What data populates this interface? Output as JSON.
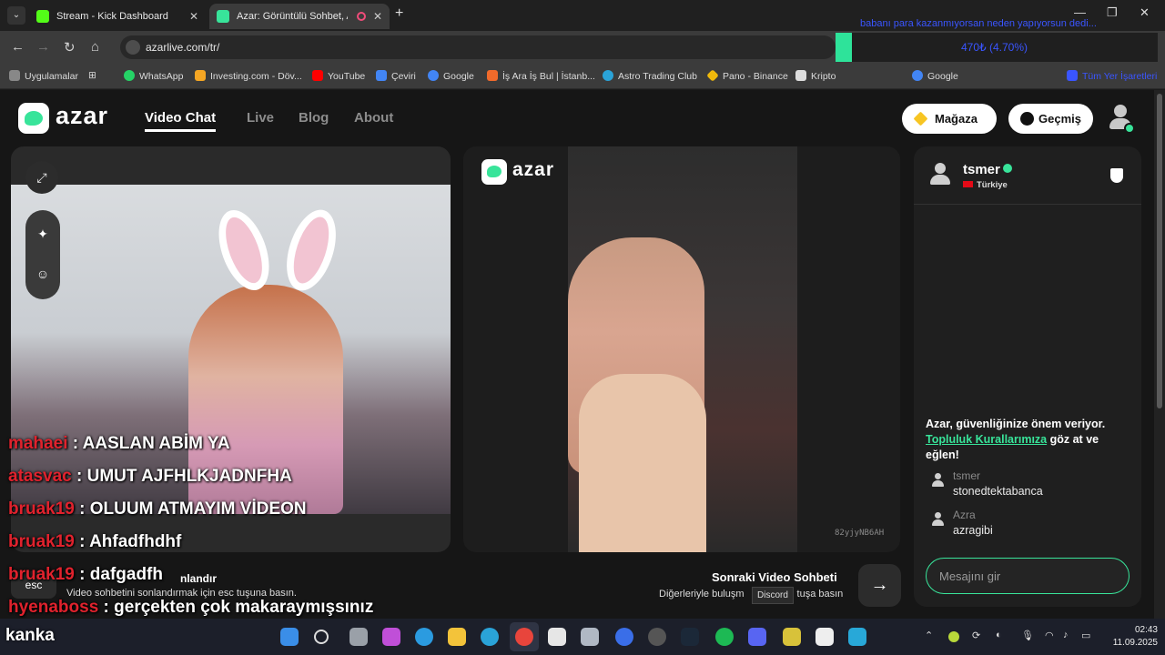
{
  "browser": {
    "tabs": [
      {
        "label": "Stream - Kick Dashboard",
        "color": "#53fc18"
      },
      {
        "label": "Azar: Görüntülü Sohbet, An",
        "color": "#38e49a"
      }
    ],
    "url": "azarlive.com/tr/",
    "bookmarks": [
      {
        "label": "Uygulamalar",
        "color": "#888888"
      },
      {
        "label": "WhatsApp",
        "color": "#25d366"
      },
      {
        "label": "Investing.com - Döv...",
        "color": "#f5a623"
      },
      {
        "label": "YouTube",
        "color": "#ff0000"
      },
      {
        "label": "Çeviri",
        "color": "#4285f4"
      },
      {
        "label": "Google",
        "color": "#4285f4"
      },
      {
        "label": "İş Ara İş Bul | İstanb...",
        "color": "#f06a2b"
      },
      {
        "label": "Astro Trading Club",
        "color": "#2aa3d8"
      },
      {
        "label": "Pano - Binance",
        "color": "#f0b90b"
      },
      {
        "label": "Kripto",
        "color": "#dddddd"
      },
      {
        "label": "Google",
        "color": "#4285f4"
      }
    ],
    "other_bookmarks": "Tüm Yer İşaretleri"
  },
  "stream_overlay": {
    "alert_text": "babanı para kazanmıyorsan neden yapıyorsun dedi...",
    "ticker_value": "470₺ (4.70%)",
    "chat_lines": [
      {
        "user": "mahaei",
        "message": "AASLAN ABİM YA"
      },
      {
        "user": "atasvac",
        "message": "UMUT AJFHLKJADNFHA"
      },
      {
        "user": "bruak19",
        "message": "OLUUM ATMAYIM VİDEON"
      },
      {
        "user": "bruak19",
        "message": "Ahfadfhdhf"
      },
      {
        "user": "bruak19",
        "message": "dafgadfh"
      },
      {
        "user": "hyenaboss",
        "message": "gerçekten çok makaraymışsınız"
      }
    ],
    "brand_text": "kanka"
  },
  "azar": {
    "logo": "azar",
    "nav": [
      "Video Chat",
      "Live",
      "Blog",
      "About"
    ],
    "active_nav": "Video Chat",
    "shop_label": "Mağaza",
    "history_label": "Geçmiş",
    "remote_user_code": "82yjyNB6AH",
    "partner": {
      "name": "tsmer",
      "country": "Türkiye"
    },
    "safety_text_1": "Azar, güvenliğinize önem veriyor.",
    "safety_link": "Topluluk Kurallarımıza",
    "safety_text_2": "göz at ve eğlen!",
    "messages": [
      {
        "sender": "tsmer",
        "text": "stonedtektabanca"
      },
      {
        "sender": "Azra",
        "text": "azragibi"
      }
    ],
    "message_placeholder": "Mesajını gir",
    "esc_key": "esc",
    "stop_label": "nlandır",
    "esc_hint": "Video sohbetini sonlandırmak için esc tuşuna basın.",
    "next_title": "Sonraki Video Sohbeti",
    "next_hint": "Diğerleriyle buluşm",
    "next_hint_tail": "tuşa basın",
    "tooltip": "Discord",
    "colors": {
      "accent": "#38e49a",
      "username_red": "#e0222d",
      "background": "#161616"
    }
  },
  "taskbar": {
    "time": "02:43",
    "date": "11.09.2025"
  }
}
